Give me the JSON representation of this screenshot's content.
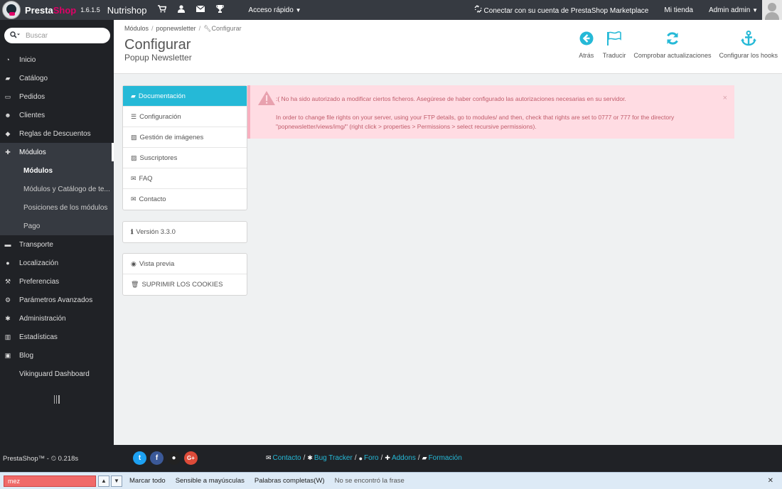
{
  "topbar": {
    "brand_a": "Presta",
    "brand_b": "Shop",
    "version": "1.6.1.5",
    "shop_name": "Nutrishop",
    "quick_access": "Acceso rápido",
    "marketplace": "Conectar con su cuenta de PrestaShop Marketplace",
    "my_shop": "Mi tienda",
    "user": "Admin admin"
  },
  "sidebar": {
    "search_placeholder": "Buscar",
    "items": [
      {
        "label": "Inicio",
        "icon": "dashboard-icon"
      },
      {
        "label": "Catálogo",
        "icon": "book-icon"
      },
      {
        "label": "Pedidos",
        "icon": "credit-card-icon"
      },
      {
        "label": "Clientes",
        "icon": "users-icon"
      },
      {
        "label": "Reglas de Descuentos",
        "icon": "tags-icon"
      },
      {
        "label": "Módulos",
        "icon": "puzzle-icon"
      },
      {
        "label": "Transporte",
        "icon": "truck-icon"
      },
      {
        "label": "Localización",
        "icon": "globe-icon"
      },
      {
        "label": "Preferencias",
        "icon": "wrench-icon"
      },
      {
        "label": "Parámetros Avanzados",
        "icon": "cogs-icon"
      },
      {
        "label": "Administración",
        "icon": "cog-icon"
      },
      {
        "label": "Estadísticas",
        "icon": "bar-chart-icon"
      },
      {
        "label": "Blog",
        "icon": "edit-icon"
      },
      {
        "label": "Vikinguard Dashboard",
        "icon": ""
      }
    ],
    "submenu": [
      {
        "label": "Módulos"
      },
      {
        "label": "Módulos y Catálogo de te..."
      },
      {
        "label": "Posiciones de los módulos"
      },
      {
        "label": "Pago"
      }
    ]
  },
  "header": {
    "breadcrumb": [
      "Módulos",
      "popnewsletter",
      "Configurar"
    ],
    "title": "Configurar",
    "subtitle": "Popup Newsletter",
    "toolbar": [
      {
        "label": "Atrás",
        "icon": "arrow-circle-left-icon"
      },
      {
        "label": "Traducir",
        "icon": "flag-icon"
      },
      {
        "label": "Comprobar actualizaciones",
        "icon": "refresh-icon"
      },
      {
        "label": "Configurar los hooks",
        "icon": "anchor-icon"
      }
    ]
  },
  "module_menu": {
    "items": [
      {
        "label": "Documentación",
        "icon": "book-icon"
      },
      {
        "label": "Configuración",
        "icon": "list-icon"
      },
      {
        "label": "Gestión de imágenes",
        "icon": "image-icon"
      },
      {
        "label": "Suscriptores",
        "icon": "image-icon"
      },
      {
        "label": "FAQ",
        "icon": "envelope-icon"
      },
      {
        "label": "Contacto",
        "icon": "envelope-icon"
      }
    ],
    "version": "Versión 3.3.0",
    "preview": "Vista previa",
    "delete_cookies": "SUPRIMIR LOS COOKIES"
  },
  "alert": {
    "line1": ":( No ha sido autorizado a modificar ciertos ficheros. Asegúrese de haber configurado las autorizaciones necesarias en su servidor.",
    "line2": "In order to change file rights on your server, using your FTP details, go to modules/ and then, check that rights are set to 0777 or 777 for the directory \"popnewsletter/views/img/\" (right click > properties > Permissions > select recursive permissions)."
  },
  "footer": {
    "version": "PrestaShop™ - ⏲ 0.218s",
    "links": [
      "Contacto",
      "Bug Tracker",
      "Foro",
      "Addons",
      "Formación"
    ]
  },
  "findbar": {
    "value": "mez",
    "highlight_all": "Marcar todo",
    "match_case": "Sensible a mayúsculas",
    "whole_words": "Palabras completas(W)",
    "status": "No se encontró la frase"
  },
  "colors": {
    "accent": "#25b9d7",
    "topbar": "#363a41",
    "sidebar": "#202226",
    "alert_bg": "#ffdce3"
  }
}
